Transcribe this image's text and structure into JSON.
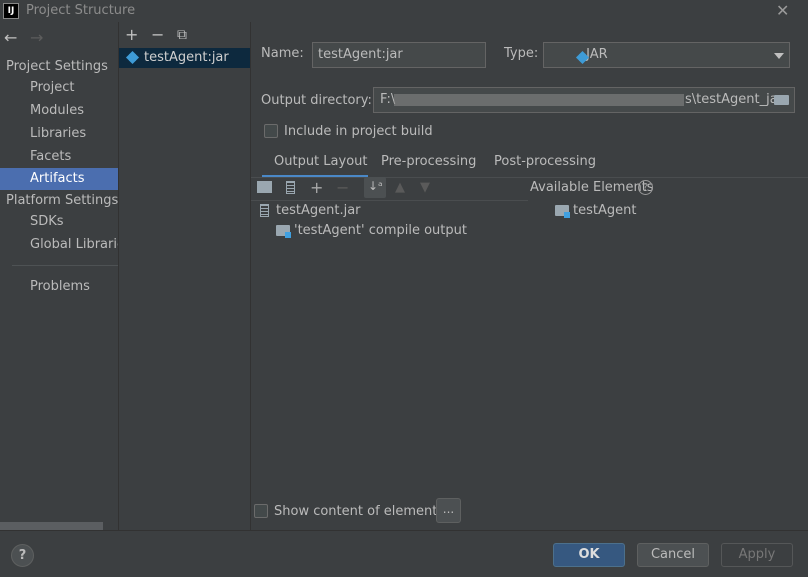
{
  "window": {
    "title": "Project Structure",
    "logo_text": "IJ",
    "close_glyph": "✕"
  },
  "nav": {
    "back_glyph": "←",
    "forward_glyph": "→"
  },
  "sidebar": {
    "project_settings_header": "Project Settings",
    "project_items": [
      "Project",
      "Modules",
      "Libraries",
      "Facets",
      "Artifacts"
    ],
    "selected_item": "Artifacts",
    "platform_settings_header": "Platform Settings",
    "platform_items": [
      "SDKs",
      "Global Libraries"
    ],
    "problems": "Problems"
  },
  "artifacts_toolbar": {
    "add": "+",
    "remove": "−",
    "copy": "⧉"
  },
  "artifacts": [
    {
      "name": "testAgent:jar",
      "icon": "artifact-diamond-icon"
    }
  ],
  "form": {
    "name_label": "Name:",
    "name_value": "testAgent:jar",
    "type_label": "Type:",
    "type_value": "JAR",
    "output_dir_label": "Output directory:",
    "output_dir_prefix": "F:\\",
    "output_dir_suffix": "s\\testAgent_jar",
    "include_build_label": "Include in project build",
    "include_build_checked": false
  },
  "tabs": [
    {
      "label": "Output Layout",
      "active": true
    },
    {
      "label": "Pre-processing",
      "active": false
    },
    {
      "label": "Post-processing",
      "active": false
    }
  ],
  "layout_tree": {
    "root": "testAgent.jar",
    "children": [
      "'testAgent' compile output"
    ]
  },
  "available": {
    "header": "Available Elements",
    "help_glyph": "?",
    "items": [
      "testAgent"
    ]
  },
  "show_content": {
    "label": "Show content of elements",
    "checked": false,
    "button": "..."
  },
  "buttons": {
    "help": "?",
    "ok": "OK",
    "cancel": "Cancel",
    "apply": "Apply"
  },
  "colors": {
    "accent": "#4b6eaf",
    "ok_button": "#365880",
    "background": "#3c3f41"
  }
}
